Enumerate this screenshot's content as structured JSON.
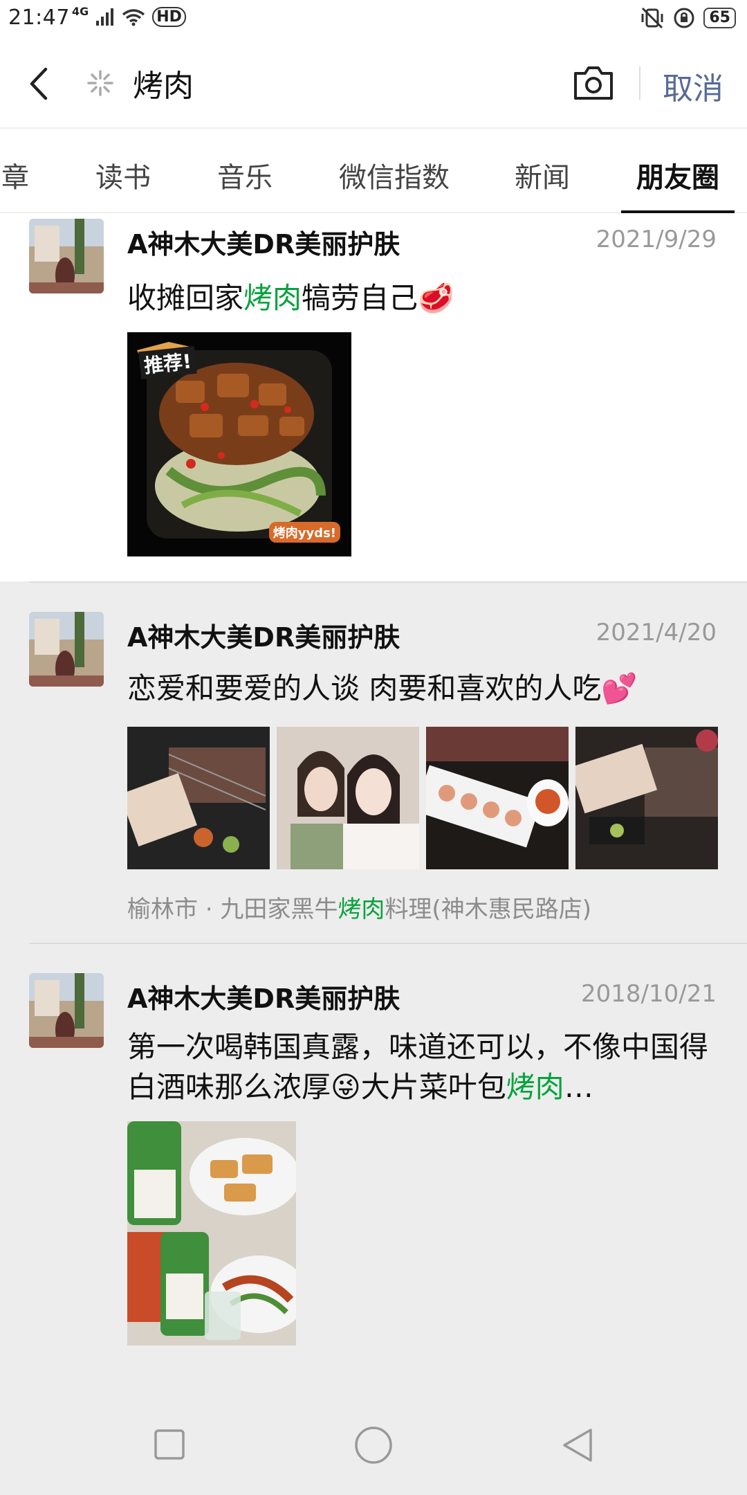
{
  "status_bar": {
    "time": "21:47",
    "network": "4G",
    "hd": "HD",
    "battery": "65"
  },
  "header": {
    "search_value": "烤肉",
    "cancel_label": "取消"
  },
  "tabs": [
    {
      "label": "章",
      "active": false
    },
    {
      "label": "读书",
      "active": false
    },
    {
      "label": "音乐",
      "active": false
    },
    {
      "label": "微信指数",
      "active": false
    },
    {
      "label": "新闻",
      "active": false
    },
    {
      "label": "朋友圈",
      "active": true
    }
  ],
  "posts": [
    {
      "author": "A神木大美DR美丽护肤",
      "date": "2021/9/29",
      "text_before": "收摊回家",
      "highlight": "烤肉",
      "text_after": "犒劳自己🥩",
      "image_stickers": [
        "推荐!",
        "烤肉yyds!"
      ]
    },
    {
      "author": "A神木大美DR美丽护肤",
      "date": "2021/4/20",
      "text": "恋爱和要爱的人谈 肉要和喜欢的人吃💕",
      "location_before": "榆林市 · 九田家黑牛",
      "location_highlight": "烤肉",
      "location_after": "料理(神木惠民路店)"
    },
    {
      "author": "A神木大美DR美丽护肤",
      "date": "2018/10/21",
      "text_before": "第一次喝韩国真露，味道还可以，不像中国得白酒味那么浓厚😜大片菜叶包",
      "highlight": "烤肉",
      "text_after": "…"
    }
  ],
  "colors": {
    "highlight": "#07a33d",
    "link": "#576b95",
    "background": "#ededed"
  }
}
